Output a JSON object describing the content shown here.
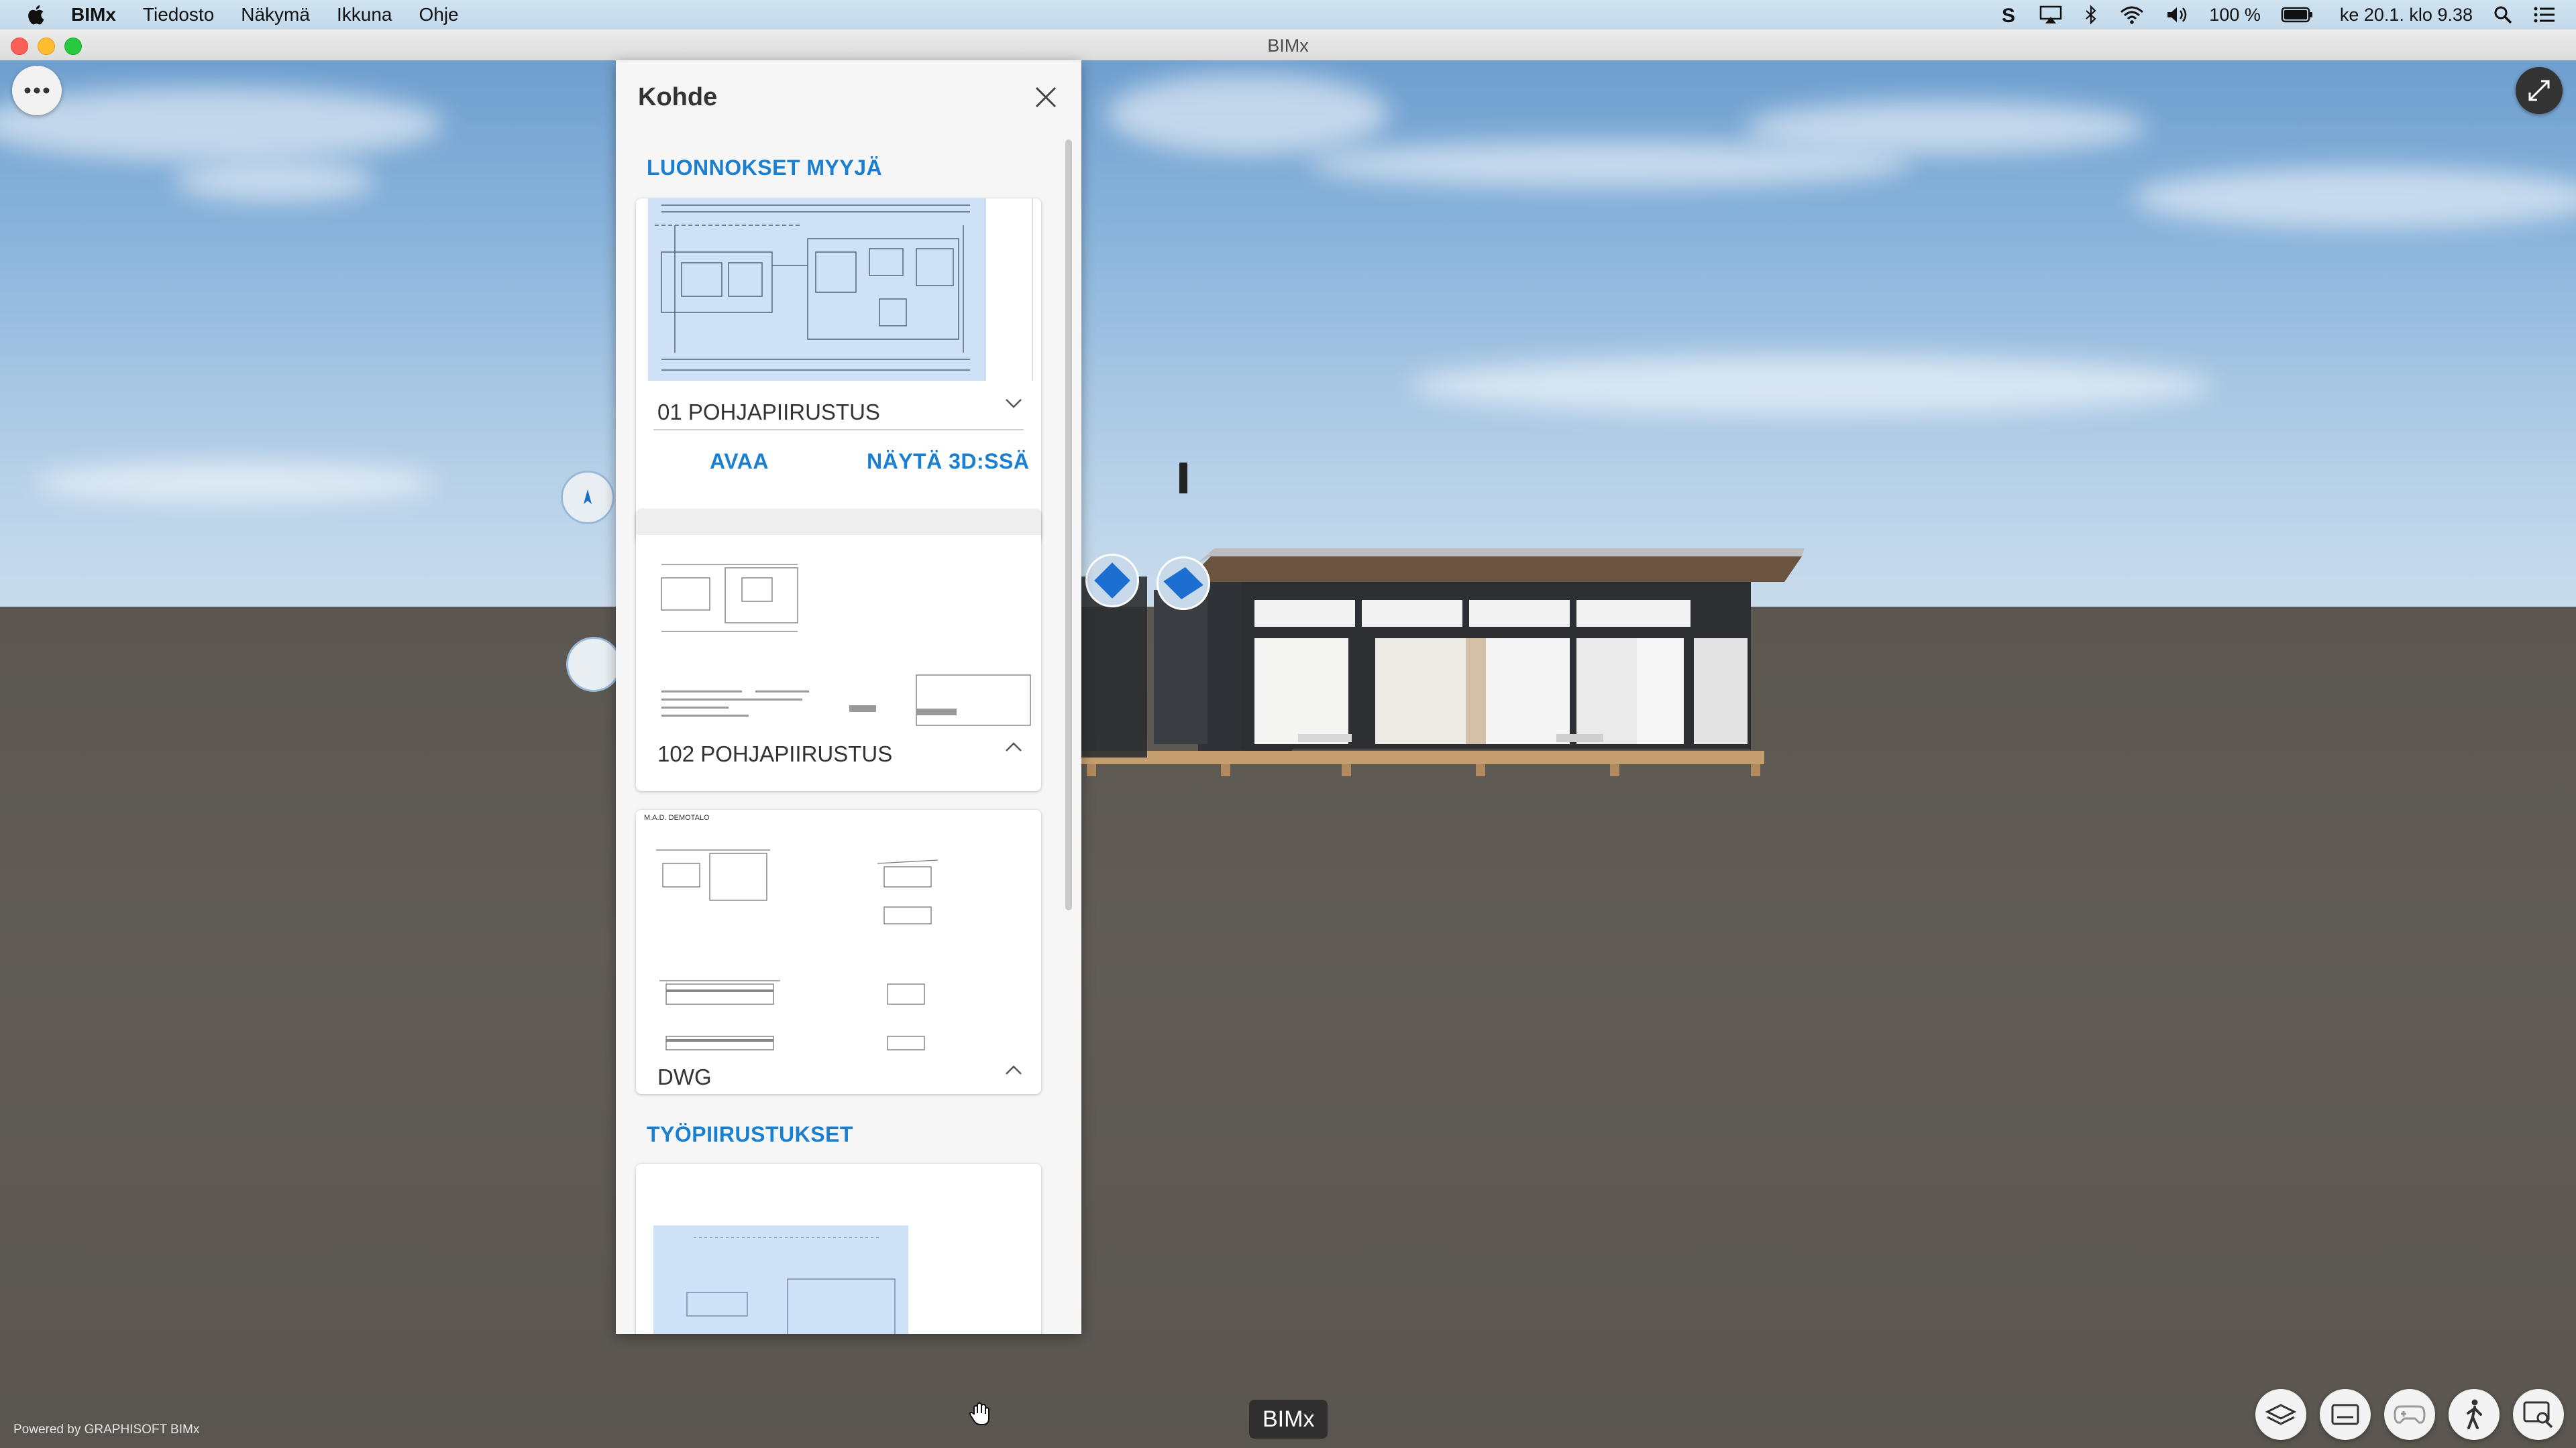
{
  "menubar": {
    "app_name": "BIMx",
    "items": [
      "Tiedosto",
      "Näkymä",
      "Ikkuna",
      "Ohje"
    ],
    "battery": "100 %",
    "datetime": "ke 20.1. klo 9.38"
  },
  "window": {
    "title": "BIMx"
  },
  "panel": {
    "title": "Kohde",
    "sections": [
      {
        "title": "LUONNOKSET MYYJÄ",
        "cards": [
          {
            "label": "01 POHJAPIIRUSTUS",
            "expanded": true,
            "actions": [
              "AVAA",
              "NÄYTÄ 3D:SSÄ"
            ]
          },
          {
            "label": "102 POHJAPIIRUSTUS",
            "expanded": false
          },
          {
            "label": "DWG",
            "expanded": false,
            "thumb_caption": "M.A.D. DEMOTALO"
          }
        ]
      },
      {
        "title": "TYÖPIIRUSTUKSET"
      }
    ]
  },
  "footer": {
    "powered_by": "Powered by GRAPHISOFT BIMx",
    "tooltip": "BIMx"
  },
  "colors": {
    "accent": "#1a7fd0",
    "panel_bg": "#f6f6f6"
  }
}
